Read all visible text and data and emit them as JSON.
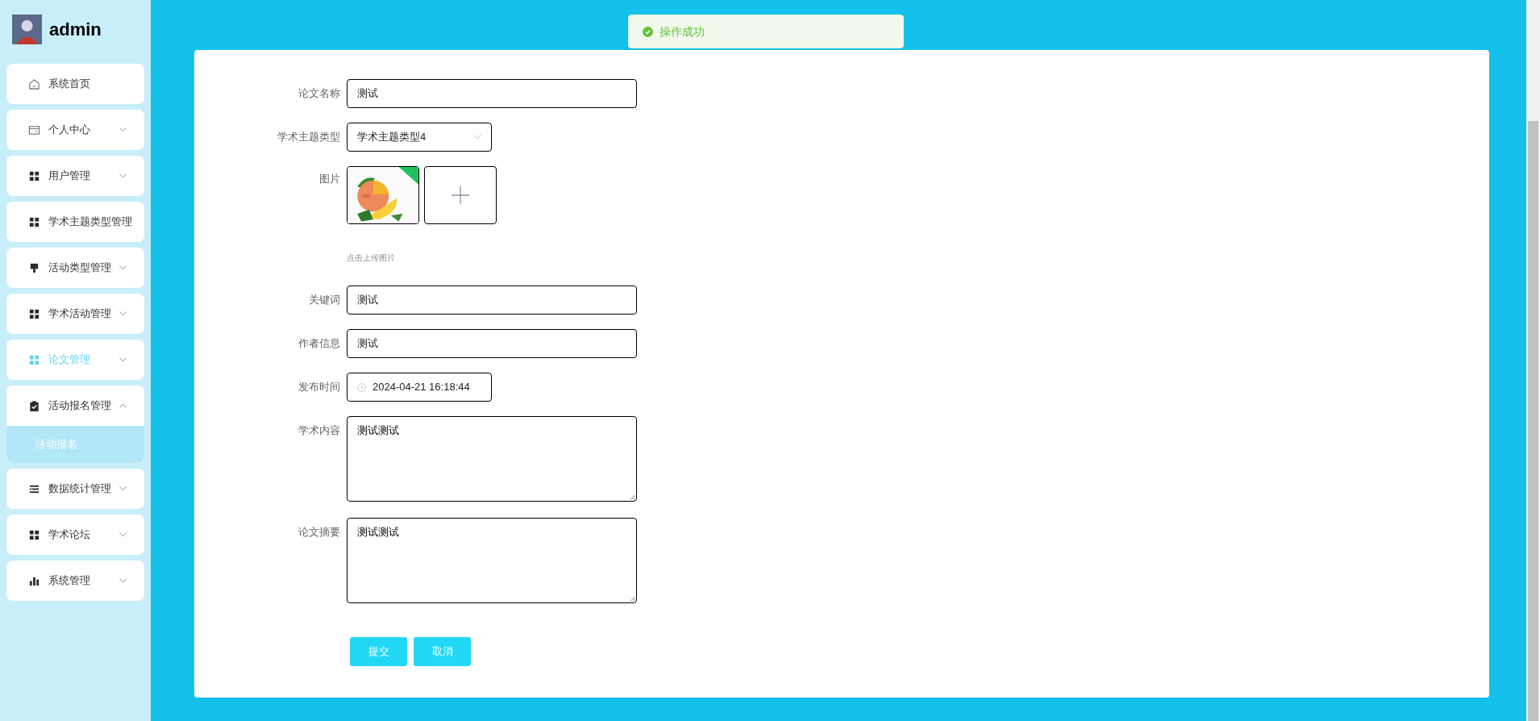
{
  "user": {
    "name": "admin"
  },
  "toast": {
    "kind": "success",
    "message": "操作成功"
  },
  "sidebar": {
    "items": [
      {
        "label": "系统首页",
        "kind": "home",
        "selected": false
      },
      {
        "label": "个人中心",
        "kind": "wallet",
        "expanded": false,
        "selected": false
      },
      {
        "label": "用户管理",
        "kind": "grid",
        "expanded": false,
        "selected": false
      },
      {
        "label": "学术主题类型管理",
        "kind": "grid",
        "selected": false
      },
      {
        "label": "活动类型管理",
        "kind": "brush",
        "expanded": false,
        "selected": false
      },
      {
        "label": "学术活动管理",
        "kind": "grid",
        "expanded": false,
        "selected": false
      },
      {
        "label": "论文管理",
        "kind": "grid",
        "expanded": false,
        "selected": true
      },
      {
        "label": "活动报名管理",
        "kind": "clipboard",
        "expanded": true,
        "selected": false,
        "children": [
          {
            "label": "活动报名",
            "selected": true
          }
        ]
      },
      {
        "label": "数据统计管理",
        "kind": "list",
        "expanded": false,
        "selected": false
      },
      {
        "label": "学术论坛",
        "kind": "grid",
        "expanded": false,
        "selected": false
      },
      {
        "label": "系统管理",
        "kind": "bars",
        "expanded": false,
        "selected": false
      }
    ]
  },
  "form": {
    "fields": [
      {
        "label": "论文名称",
        "kind": "text",
        "value": "测试"
      },
      {
        "label": "学术主题类型",
        "kind": "select",
        "value": "学术主题类型4"
      },
      {
        "label": "图片",
        "kind": "upload",
        "hint": "点击上传图片"
      },
      {
        "label": "关键词",
        "kind": "text",
        "value": "测试"
      },
      {
        "label": "作者信息",
        "kind": "text",
        "value": "测试"
      },
      {
        "label": "发布时间",
        "kind": "datetime",
        "value": "2024-04-21 16:18:44"
      },
      {
        "label": "学术内容",
        "kind": "textarea",
        "value": "测试测试"
      },
      {
        "label": "论文摘要",
        "kind": "textarea",
        "value": "测试测试"
      }
    ],
    "buttons": [
      "提交",
      "取消"
    ]
  }
}
